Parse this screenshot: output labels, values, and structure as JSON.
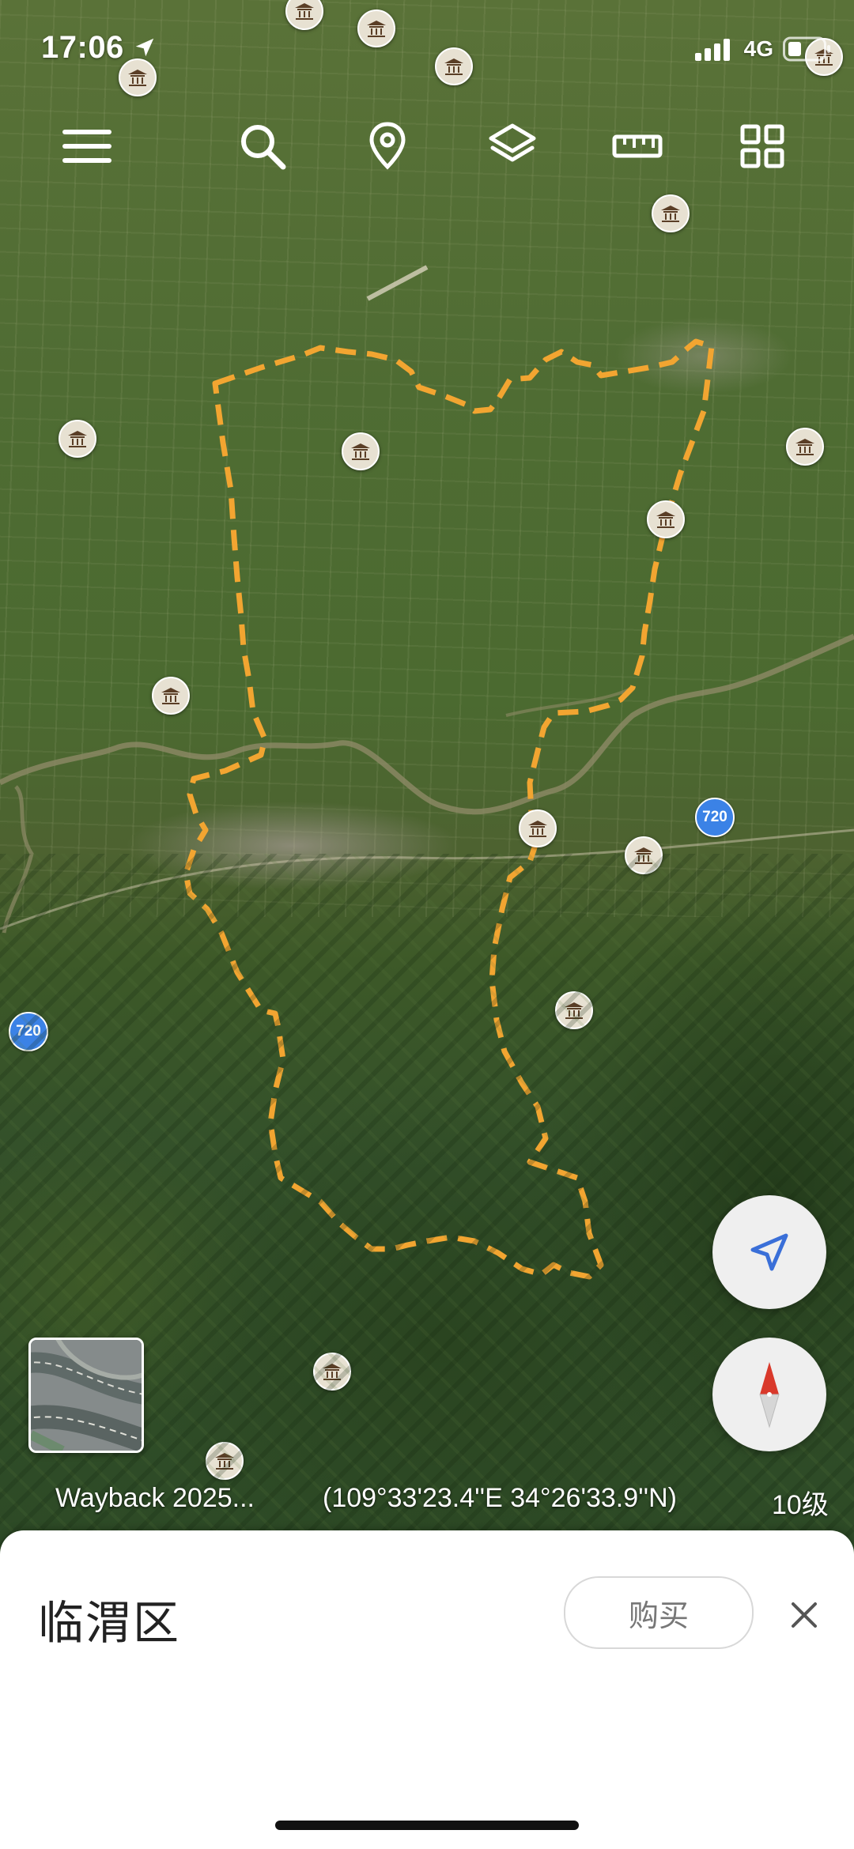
{
  "status_bar": {
    "time": "17:06",
    "network": "4G"
  },
  "toolbar": {
    "menu": "menu-icon",
    "search": "search-icon",
    "location": "location-pin-icon",
    "layers": "layers-icon",
    "measure": "ruler-icon",
    "grid": "grid-icon"
  },
  "map": {
    "road_labels": [
      "720",
      "720"
    ],
    "boundary_color": "#f2a531",
    "poi_icon": "temple-icon"
  },
  "info_strip": {
    "imagery": "Wayback 2025...",
    "coordinates": "(109°33'23.4''E 34°26'33.9''N)",
    "zoom": "10级"
  },
  "sheet": {
    "place_name": "临渭区",
    "buy_label": "购买",
    "close": "close-icon"
  },
  "colors": {
    "accent_blue": "#3a6fd8",
    "compass_red": "#d9392b"
  }
}
